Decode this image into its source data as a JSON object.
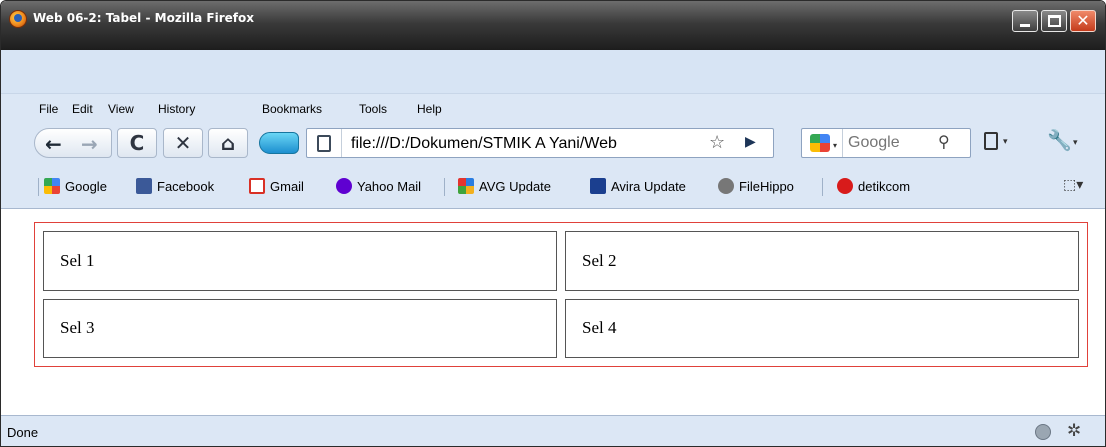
{
  "window": {
    "title": "Web 06-2: Tabel - Mozilla Firefox",
    "controls": {
      "minimize": "",
      "maximize": "",
      "close": "✕"
    }
  },
  "menu": [
    "File",
    "Edit",
    "View",
    "History",
    "Bookmarks",
    "Tools",
    "Help"
  ],
  "nav": {
    "back": "←",
    "forward": "→",
    "reload": "C",
    "stop": "✕",
    "home": "⌂",
    "url": "file:///D:/Dokumen/STMIK A Yani/Web",
    "bookmark_star": "☆",
    "go": "▶"
  },
  "search": {
    "placeholder": "Google",
    "search_icon": "⚲"
  },
  "bookmarks": [
    {
      "label": "Google",
      "icon": "google-icon",
      "color": "#4285f4"
    },
    {
      "label": "Facebook",
      "icon": "facebook-icon",
      "color": "#3b5998"
    },
    {
      "label": "Gmail",
      "icon": "gmail-icon",
      "color": "#d93025"
    },
    {
      "label": "Yahoo Mail",
      "icon": "yahoo-icon",
      "color": "#5f01d1"
    },
    {
      "label": "AVG Update",
      "icon": "avg-icon",
      "color": "#2a7de1"
    },
    {
      "label": "Avira Update",
      "icon": "avira-icon",
      "color": "#1b3f8f"
    },
    {
      "label": "FileHippo",
      "icon": "filehippo-icon",
      "color": "#555555"
    },
    {
      "label": "detikcom",
      "icon": "detikcom-icon",
      "color": "#d81b1b"
    }
  ],
  "table": {
    "rows": [
      [
        "Sel 1",
        "Sel 2"
      ],
      [
        "Sel 3",
        "Sel 4"
      ]
    ]
  },
  "status": {
    "text": "Done"
  },
  "colors": {
    "chrome": "#dce7f5",
    "table_border": "#e0413a"
  }
}
